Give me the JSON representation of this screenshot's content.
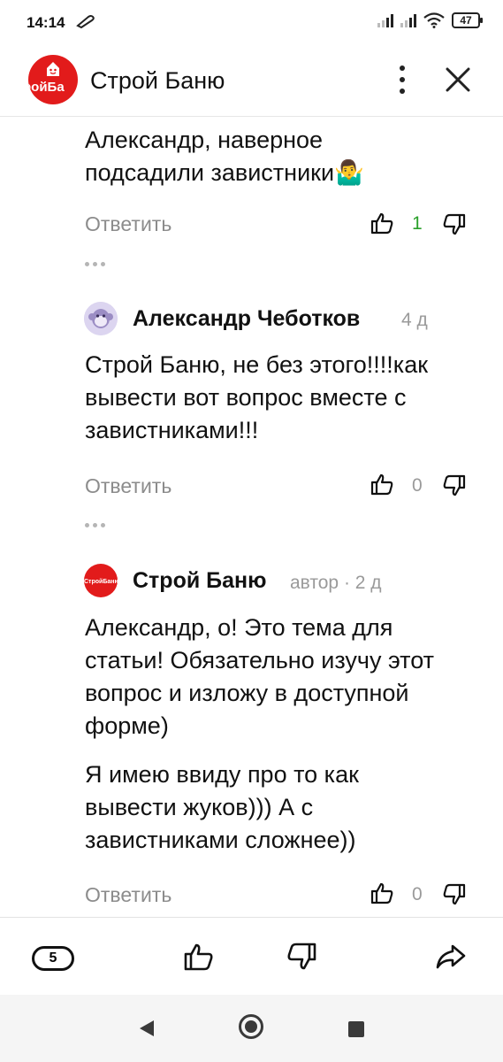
{
  "status_bar": {
    "time": "14:14",
    "battery": "47"
  },
  "header": {
    "logo_text": "ройБа",
    "title": "Строй Баню"
  },
  "comments": [
    {
      "text": "Александр, наверное подсадили завистники🤷‍♂️",
      "reply_label": "Ответить",
      "likes": "1"
    },
    {
      "author": "Александр Чеботков",
      "meta": "4 д",
      "text": "Строй Баню, не без этого!!!!как вывести вот вопрос вместе с завистниками!!!",
      "reply_label": "Ответить",
      "likes": "0"
    },
    {
      "author": "Строй Баню",
      "avatar_text": "СтройБаню",
      "meta": "автор · 2 д",
      "text_1": "Александр, о! Это тема для статьи! Обязательно изучу этот вопрос и изложу в доступной форме)",
      "text_2": "Я имею ввиду про то как вывести жуков))) А с завистниками сложнее))",
      "reply_label": "Ответить",
      "likes": "0"
    }
  ],
  "bottom_bar": {
    "comments_count": "5"
  },
  "colors": {
    "brand_red": "#e21b1b",
    "like_green": "#2aa02a"
  },
  "icons": [
    "pencil-icon",
    "signal-icon",
    "wifi-icon",
    "battery-icon",
    "more-icon",
    "close-icon",
    "thumb-up-icon",
    "thumb-down-icon",
    "share-icon",
    "back-icon",
    "home-icon",
    "recents-icon"
  ]
}
